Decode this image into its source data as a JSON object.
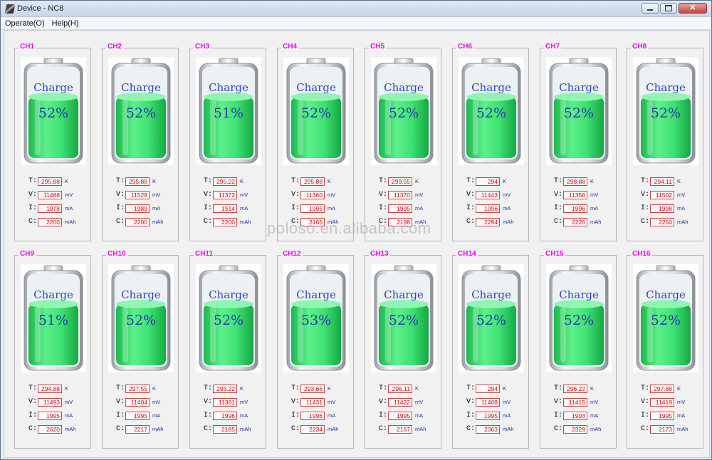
{
  "window": {
    "title": "Device - NC8",
    "icon": "app-icon",
    "controls": [
      "minimize-icon",
      "maximize-icon",
      "close-icon"
    ]
  },
  "menu": [
    {
      "label": "Operate(O)"
    },
    {
      "label": "Help(H)"
    }
  ],
  "watermark": "poloso.en.alibaba.com",
  "field_labels": {
    "t": "T:",
    "v": "V:",
    "i": "I:",
    "c": "C:"
  },
  "units": {
    "t": "K",
    "v": "mV",
    "i": "mA",
    "c": "mAh"
  },
  "colors": {
    "channel_label": "#ff00ff",
    "value_text": "#dd0000",
    "charge_text": "#2a46c8",
    "battery_fill": "#22dd66"
  },
  "channels": [
    {
      "name": "CH1",
      "status": "Charge",
      "percent": "52%",
      "t": "295.88",
      "v": "11488",
      "i": "1978",
      "c": "2200"
    },
    {
      "name": "CH2",
      "status": "Charge",
      "percent": "52%",
      "t": "295.88",
      "v": "11528",
      "i": "1989",
      "c": "2200"
    },
    {
      "name": "CH3",
      "status": "Charge",
      "percent": "51%",
      "t": "295.22",
      "v": "11372",
      "i": "1514",
      "c": "2200"
    },
    {
      "name": "CH4",
      "status": "Charge",
      "percent": "52%",
      "t": "295.88",
      "v": "11360",
      "i": "1995",
      "c": "2165"
    },
    {
      "name": "CH5",
      "status": "Charge",
      "percent": "52%",
      "t": "299.55",
      "v": "11370",
      "i": "1995",
      "c": "2198"
    },
    {
      "name": "CH6",
      "status": "Charge",
      "percent": "52%",
      "t": "294",
      "v": "11443",
      "i": "1996",
      "c": "2294"
    },
    {
      "name": "CH7",
      "status": "Charge",
      "percent": "52%",
      "t": "298.88",
      "v": "11356",
      "i": "1996",
      "c": "2226"
    },
    {
      "name": "CH8",
      "status": "Charge",
      "percent": "52%",
      "t": "294.11",
      "v": "11502",
      "i": "1998",
      "c": "2250"
    },
    {
      "name": "CH9",
      "status": "Charge",
      "percent": "51%",
      "t": "294.88",
      "v": "11493",
      "i": "1995",
      "c": "2620"
    },
    {
      "name": "CH10",
      "status": "Charge",
      "percent": "52%",
      "t": "297.55",
      "v": "11404",
      "i": "1995",
      "c": "2217"
    },
    {
      "name": "CH11",
      "status": "Charge",
      "percent": "52%",
      "t": "293.22",
      "v": "11381",
      "i": "1996",
      "c": "2185"
    },
    {
      "name": "CH12",
      "status": "Charge",
      "percent": "53%",
      "t": "293.66",
      "v": "11431",
      "i": "1996",
      "c": "2234"
    },
    {
      "name": "CH13",
      "status": "Charge",
      "percent": "52%",
      "t": "296.11",
      "v": "11422",
      "i": "1995",
      "c": "2167"
    },
    {
      "name": "CH14",
      "status": "Charge",
      "percent": "52%",
      "t": "294",
      "v": "11408",
      "i": "1995",
      "c": "2363"
    },
    {
      "name": "CH15",
      "status": "Charge",
      "percent": "52%",
      "t": "296.22",
      "v": "11415",
      "i": "1993",
      "c": "2329"
    },
    {
      "name": "CH16",
      "status": "Charge",
      "percent": "52%",
      "t": "297.88",
      "v": "11419",
      "i": "1995",
      "c": "2173"
    }
  ]
}
